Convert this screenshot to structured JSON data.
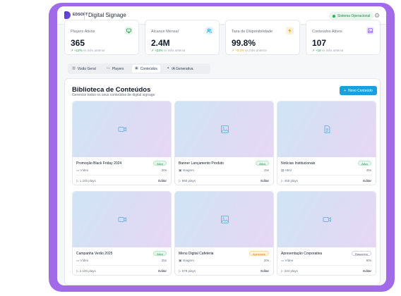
{
  "header": {
    "logo_text": "EDSOFT",
    "app_title": "Digital Signage",
    "status": "Sistema Operacional"
  },
  "stats": [
    {
      "label": "Players Ativos",
      "value": "365",
      "change": "+12%",
      "suffix": "vs mês anterior",
      "icon": "monitor-icon",
      "color": "#16a34a"
    },
    {
      "label": "Alcance Mensal",
      "value": "2.4M",
      "change": "+23%",
      "suffix": "vs mês anterior",
      "icon": "users-icon",
      "color": "#1aa0dc"
    },
    {
      "label": "Taxa de Disponibilidade",
      "value": "99.8%",
      "change": "+0.2%",
      "suffix": "vs mês anterior",
      "icon": "bolt-icon",
      "color": "#f59e0b"
    },
    {
      "label": "Conteúdos Ativos",
      "value": "107",
      "change": "+18",
      "suffix": "vs mês anterior",
      "icon": "image-icon",
      "color": "#8b5cf6"
    }
  ],
  "tabs": [
    {
      "label": "Visão Geral"
    },
    {
      "label": "Players"
    },
    {
      "label": "Conteúdos"
    },
    {
      "label": "IA Generativa"
    }
  ],
  "library": {
    "title": "Biblioteca de Conteúdos",
    "subtitle": "Gerencie todos os seus conteúdos de digital signage",
    "new_button": "Novo Conteúdo",
    "items": [
      {
        "title": "Promoção Black Friday 2024",
        "status": "Ativo",
        "type": "Vídeo",
        "duration": "20s",
        "plays": "1.245 plays",
        "edit": "Editar"
      },
      {
        "title": "Banner Lançamento Produto",
        "status": "Ativo",
        "type": "Imagem",
        "duration": "15s",
        "plays": "890 plays",
        "edit": "Editar"
      },
      {
        "title": "Notícias Institucionais",
        "status": "Ativo",
        "type": "Html",
        "duration": "45s",
        "plays": "456 plays",
        "edit": "Editar"
      },
      {
        "title": "Campanha Verão 2025",
        "status": "Ativo",
        "type": "Vídeo",
        "duration": "25s",
        "plays": "2.100 plays",
        "edit": "Editar"
      },
      {
        "title": "Menu Digital Cafeteria",
        "status": "Agendado",
        "type": "Imagem",
        "duration": "20s",
        "plays": "678 plays",
        "edit": "Editar"
      },
      {
        "title": "Apresentação Corporativa",
        "status": "Rascunho",
        "type": "Vídeo",
        "duration": "60s",
        "plays": "234 plays",
        "edit": "Editar"
      }
    ]
  }
}
